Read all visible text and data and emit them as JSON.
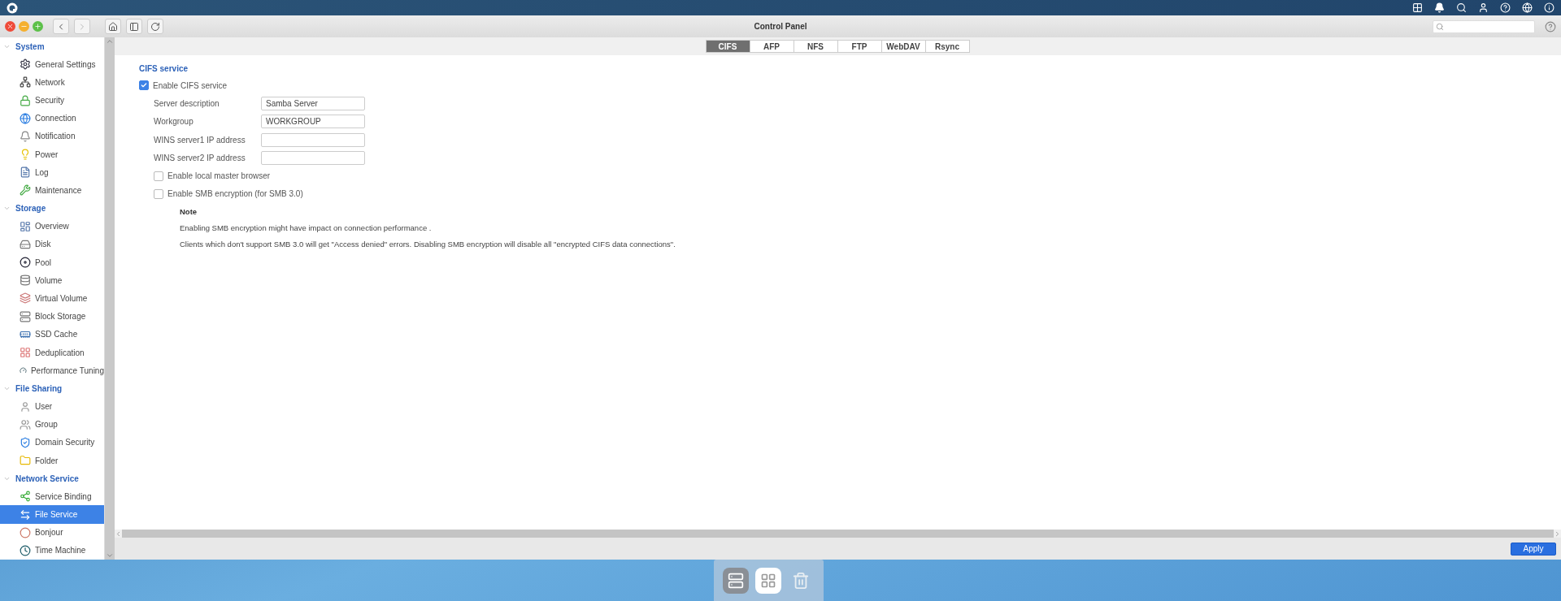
{
  "window": {
    "title": "Control Panel"
  },
  "sidebar": {
    "groups": [
      {
        "label": "System",
        "expanded": true,
        "items": [
          {
            "label": "General Settings",
            "selected": false
          },
          {
            "label": "Network",
            "selected": false
          },
          {
            "label": "Security",
            "selected": false
          },
          {
            "label": "Connection",
            "selected": false
          },
          {
            "label": "Notification",
            "selected": false
          },
          {
            "label": "Power",
            "selected": false
          },
          {
            "label": "Log",
            "selected": false
          },
          {
            "label": "Maintenance",
            "selected": false
          }
        ]
      },
      {
        "label": "Storage",
        "expanded": true,
        "items": [
          {
            "label": "Overview",
            "selected": false
          },
          {
            "label": "Disk",
            "selected": false
          },
          {
            "label": "Pool",
            "selected": false
          },
          {
            "label": "Volume",
            "selected": false
          },
          {
            "label": "Virtual Volume",
            "selected": false
          },
          {
            "label": "Block Storage",
            "selected": false
          },
          {
            "label": "SSD Cache",
            "selected": false
          },
          {
            "label": "Deduplication",
            "selected": false
          },
          {
            "label": "Performance Tuning",
            "selected": false
          }
        ]
      },
      {
        "label": "File Sharing",
        "expanded": true,
        "items": [
          {
            "label": "User",
            "selected": false
          },
          {
            "label": "Group",
            "selected": false
          },
          {
            "label": "Domain Security",
            "selected": false
          },
          {
            "label": "Folder",
            "selected": false
          }
        ]
      },
      {
        "label": "Network Service",
        "expanded": true,
        "items": [
          {
            "label": "Service Binding",
            "selected": false
          },
          {
            "label": "File Service",
            "selected": true
          },
          {
            "label": "Bonjour",
            "selected": false
          },
          {
            "label": "Time Machine",
            "selected": false
          }
        ]
      }
    ]
  },
  "tabs": [
    {
      "label": "CIFS",
      "selected": true
    },
    {
      "label": "AFP",
      "selected": false
    },
    {
      "label": "NFS",
      "selected": false
    },
    {
      "label": "FTP",
      "selected": false
    },
    {
      "label": "WebDAV",
      "selected": false
    },
    {
      "label": "Rsync",
      "selected": false
    }
  ],
  "form": {
    "section_title": "CIFS service",
    "enable": {
      "label": "Enable CIFS service",
      "checked": true
    },
    "fields": [
      {
        "label": "Server description",
        "value": "Samba Server"
      },
      {
        "label": "Workgroup",
        "value": "WORKGROUP"
      },
      {
        "label": "WINS server1 IP address"
      },
      {
        "label": "WINS server2 IP address"
      }
    ],
    "options": [
      {
        "label": "Enable local master browser",
        "checked": false
      },
      {
        "label": "Enable SMB encryption (for SMB 3.0)",
        "checked": false
      }
    ],
    "note": {
      "title": "Note",
      "lines": [
        "Enabling SMB encryption might have impact on connection performance .",
        "Clients which don't support SMB 3.0 will get \"Access denied\" errors. Disabling SMB encryption will disable all \"encrypted CIFS data connections\"."
      ]
    }
  },
  "footer": {
    "apply": "Apply"
  }
}
